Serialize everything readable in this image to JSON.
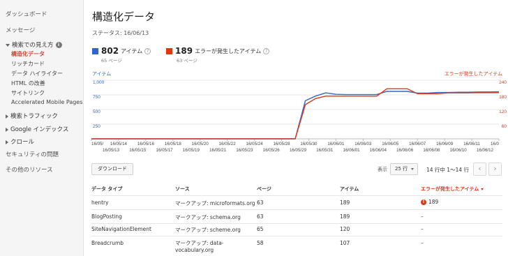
{
  "sidebar": {
    "dashboard": "ダッシュボード",
    "messages": "メッセージ",
    "search_appearance": "検索での見え方",
    "structured_data": "構造化データ",
    "rich_cards": "リッチカード",
    "data_highlighter": "データ ハイライター",
    "html_improvements": "HTML の改善",
    "sitelinks": "サイトリンク",
    "amp": "Accelerated Mobile Pages",
    "search_traffic": "検索トラフィック",
    "google_index": "Google インデックス",
    "crawl": "クロール",
    "security": "セキュリティの問題",
    "other_resources": "その他のリソース"
  },
  "header": {
    "title": "構造化データ",
    "status": "ステータス: 16/06/13"
  },
  "stats": {
    "items_count": "802",
    "items_label": "アイテム",
    "items_pages": "65 ページ",
    "errors_count": "189",
    "errors_label": "エラーが発生したアイテム",
    "errors_pages": "63 ページ",
    "colors": {
      "items": "#3366cc",
      "errors": "#dc3912"
    }
  },
  "chart_data": {
    "type": "line",
    "left_axis_label": "アイテム",
    "right_axis_label": "エラーが発生したアイテム",
    "left_ticks": [
      "1,000",
      "750",
      "500",
      "250"
    ],
    "right_ticks": [
      "240",
      "180",
      "120",
      "60"
    ],
    "left_ylim": [
      0,
      1000
    ],
    "right_ylim": [
      0,
      240
    ],
    "x_top_labels": [
      "16/05/",
      "16/05/14",
      "16/05/16",
      "16/05/18",
      "16/05/20",
      "16/05/22",
      "16/05/24",
      "16/05/28",
      "16/05/30",
      "16/06/01",
      "16/06/03",
      "16/06/05",
      "16/06/07",
      "16/06/09",
      "16/06/11",
      "16/0"
    ],
    "x_bottom_labels": [
      "16/05/13",
      "16/05/15",
      "16/05/17",
      "16/05/19",
      "16/05/21",
      "16/05/23",
      "16/05/26",
      "16/05/29",
      "16/05/31",
      "16/06/01",
      "16/06/04",
      "16/06/06",
      "16/06/08",
      "16/06/10",
      "16/06/12"
    ],
    "series": [
      {
        "name": "アイテム",
        "axis": "left",
        "color": "#3366cc",
        "values": [
          0,
          0,
          0,
          0,
          0,
          0,
          0,
          0,
          0,
          0,
          0,
          0,
          0,
          0,
          0,
          0,
          0,
          0,
          0,
          0,
          0,
          650,
          730,
          785,
          760,
          755,
          755,
          755,
          755,
          810,
          810,
          810,
          780,
          780,
          790,
          790,
          795,
          795,
          800,
          800,
          802
        ]
      },
      {
        "name": "エラーが発生したアイテム",
        "axis": "right",
        "color": "#dc3912",
        "values": [
          0,
          0,
          0,
          0,
          0,
          0,
          0,
          0,
          0,
          0,
          0,
          0,
          0,
          0,
          0,
          0,
          0,
          0,
          0,
          0,
          0,
          140,
          165,
          175,
          175,
          175,
          175,
          175,
          175,
          205,
          205,
          205,
          185,
          185,
          185,
          188,
          188,
          188,
          189,
          189,
          189
        ]
      }
    ],
    "grid": true
  },
  "toolbar": {
    "download": "ダウンロード",
    "show_label": "表示",
    "rows_option": "25 行",
    "range_text": "14 行中 1〜14 行",
    "prev": "‹",
    "next": "›"
  },
  "table": {
    "headers": [
      "データ タイプ",
      "ソース",
      "ページ",
      "アイテム",
      "エラーが発生したアイテム"
    ],
    "rows": [
      {
        "type": "hentry",
        "source": "マークアップ: microformats.org",
        "pages": "63",
        "items": "189",
        "errors": "189"
      },
      {
        "type": "BlogPosting",
        "source": "マークアップ: schema.org",
        "pages": "63",
        "items": "189",
        "errors": "–"
      },
      {
        "type": "SiteNavigationElement",
        "source": "マークアップ: scheme.org",
        "pages": "65",
        "items": "120",
        "errors": "–"
      },
      {
        "type": "Breadcrumb",
        "source": "マークアップ: data-vocabulary.org",
        "pages": "58",
        "items": "107",
        "errors": "–"
      }
    ]
  }
}
